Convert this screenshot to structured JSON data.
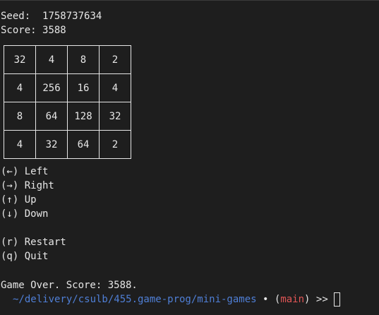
{
  "header": {
    "seed_label": "Seed:",
    "seed_value": "1758737634",
    "score_label": "Score:",
    "score_value": "3588"
  },
  "board": [
    [
      "32",
      "4",
      "8",
      "2"
    ],
    [
      "4",
      "256",
      "16",
      "4"
    ],
    [
      "8",
      "64",
      "128",
      "32"
    ],
    [
      "4",
      "32",
      "64",
      "2"
    ]
  ],
  "controls": [
    "(←) Left",
    "(→) Right",
    "(↑) Up",
    "(↓) Down",
    "",
    "(r) Restart",
    "(q) Quit"
  ],
  "status": "Game Over. Score: 3588.",
  "prompt": {
    "path": "~/delivery/csulb/455.game-prog/mini-games",
    "dot": "•",
    "branch_open": "(",
    "branch": "main",
    "branch_close": ")",
    "symbol": ">>"
  },
  "colors": {
    "background": "#1e1e1e",
    "text": "#e6e6e6",
    "path": "#4f7fd6",
    "branch": "#e05555"
  }
}
